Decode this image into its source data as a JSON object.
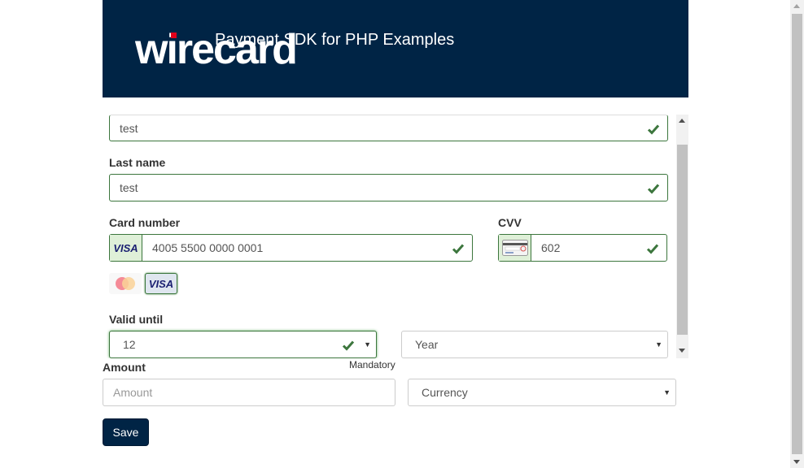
{
  "header": {
    "logo_text": "wirecard",
    "title": "Payment SDK for PHP Examples"
  },
  "form": {
    "first_name_value": "test",
    "last_name_label": "Last name",
    "last_name_value": "test",
    "card_number_label": "Card number",
    "card_number_value": "4005 5500 0000 0001",
    "card_brand_addon": "VISA",
    "cvv_label": "CVV",
    "cvv_value": "602",
    "brands": [
      "MasterCard",
      "VISA"
    ],
    "valid_until_label": "Valid until",
    "month_value": "12",
    "year_value": "Year",
    "mandatory_text": "Mandatory"
  },
  "amount": {
    "label": "Amount",
    "placeholder": "Amount",
    "currency_value": "Currency"
  },
  "save_label": "Save",
  "colors": {
    "header_bg": "#002445",
    "valid_border": "#3c763d",
    "check_green": "#3c763d",
    "button_bg": "#002445"
  }
}
